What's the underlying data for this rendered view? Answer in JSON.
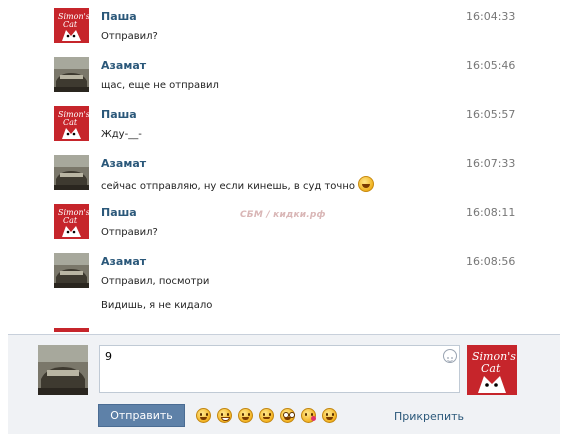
{
  "messages": [
    {
      "author": "Паша",
      "time": "16:04:33",
      "text": "Отправил?",
      "avatar": "pasha"
    },
    {
      "author": "Азамат",
      "time": "16:05:46",
      "text": "щас, еще не отправил",
      "avatar": "azamat"
    },
    {
      "author": "Паша",
      "time": "16:05:57",
      "text": "Жду-__-",
      "avatar": "pasha"
    },
    {
      "author": "Азамат",
      "time": "16:07:33",
      "text": "сейчас отправляю, ну если кинешь, в суд точно",
      "avatar": "azamat",
      "emoji": "persevere-emoji-icon"
    },
    {
      "author": "Паша",
      "time": "16:08:11",
      "text": "Отправил?",
      "avatar": "pasha"
    },
    {
      "author": "Азамат",
      "time": "16:08:56",
      "text": "Отправил, посмотри",
      "text2": "Видишь, я не кидало",
      "avatar": "azamat"
    }
  ],
  "watermark": "СБМ / кидки.рф",
  "composer": {
    "input_value": "9",
    "send_label": "Отправить",
    "attach_label": "Прикрепить",
    "emojis": [
      "persevere-emoji-icon",
      "grin-emoji-icon",
      "smile-emoji-icon",
      "blush-emoji-icon",
      "nerd-emoji-icon",
      "kiss-emoji-icon",
      "happy-emoji-icon"
    ]
  },
  "colors": {
    "name": "#2b587a",
    "send_button": "#5e81a8",
    "composer_bg": "#f0f2f5",
    "pasha_avatar": "#c6252b"
  }
}
